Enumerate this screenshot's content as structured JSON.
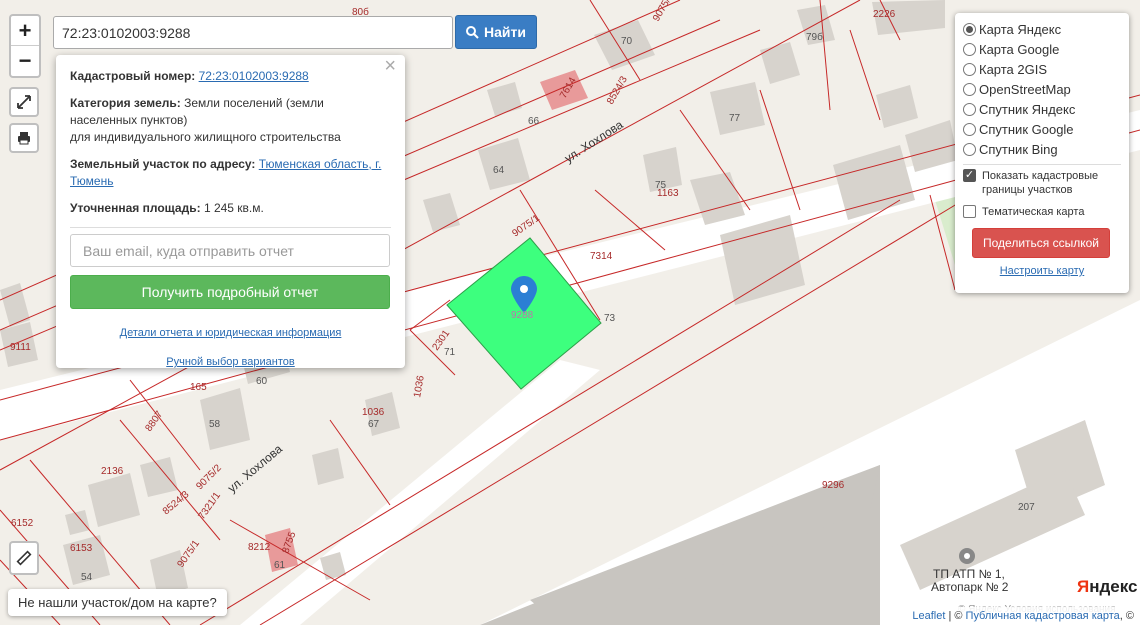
{
  "search": {
    "value": "72:23:0102003:9288",
    "button_label": "Найти"
  },
  "zoom": {
    "in": "+",
    "out": "−"
  },
  "popup": {
    "cadastral_label": "Кадастровый номер:",
    "cadastral_number": "72:23:0102003:9288",
    "category_label": "Категория земель:",
    "category_value": "Земли поселений (земли населенных пунктов)",
    "category_use": "для индивидуального жилищного строительства",
    "address_label": "Земельный участок по адресу:",
    "address_value": "Тюменская область, г. Тюмень",
    "area_label": "Уточненная площадь:",
    "area_value": "1 245 кв.м.",
    "email_placeholder": "Ваш email, куда отправить отчет",
    "report_button": "Получить подробный отчет",
    "details_link": "Детали отчета и юридическая информация",
    "manual_link": "Ручной выбор вариантов"
  },
  "layers": {
    "options": [
      {
        "label": "Карта Яндекс",
        "selected": true
      },
      {
        "label": "Карта Google",
        "selected": false
      },
      {
        "label": "Карта 2GIS",
        "selected": false
      },
      {
        "label": "OpenStreetMap",
        "selected": false
      },
      {
        "label": "Спутник Яндекс",
        "selected": false
      },
      {
        "label": "Спутник Google",
        "selected": false
      },
      {
        "label": "Спутник Bing",
        "selected": false
      }
    ],
    "show_borders": {
      "label": "Показать кадастровые границы участков",
      "checked": true
    },
    "thematic": {
      "label": "Тематическая карта",
      "checked": false
    },
    "share_button": "Поделиться ссылкой",
    "configure_link": "Настроить карту"
  },
  "bottom_tip": "Не нашли участок/дом на карте?",
  "attribution": {
    "leaflet": "Leaflet",
    "sep": " | © ",
    "source": "Публичная кадастровая карта",
    "tail": ", ©"
  },
  "yandex": {
    "logo_1": "Я",
    "logo_2": "ндекс",
    "legal": "© Яндекс  Условия использования"
  },
  "map_labels": {
    "street_1": "ул. Хохлова",
    "street_2": "ул. Хохлова",
    "l1": "80б",
    "l2": "70",
    "l3": "79б",
    "l4": "2226",
    "l5": "9075/1",
    "l6": "7614",
    "l7": "8524/3",
    "l8": "66",
    "l9": "77",
    "l10": "64",
    "l11": "75",
    "l12": "1163",
    "l13": "9075/1",
    "l14": "7314",
    "l15": "9288",
    "l16": "73",
    "l17": "2301",
    "l18": "71",
    "l19": "1036",
    "l20": "165",
    "l21": "60",
    "l22": "9111",
    "l23": "8807",
    "l24": "58",
    "l25": "1036",
    "l26": "67",
    "l27": "2136",
    "l28": "9075/2",
    "l29": "8524/3",
    "l30": "7321/1",
    "l31": "6152",
    "l32": "6153",
    "l33": "54",
    "l34": "9075/1",
    "l35": "8212",
    "l36": "8755",
    "l37": "61",
    "l38": "9296",
    "l39": "207",
    "poi_1": "ТП АТП № 1,",
    "poi_2": "Автопарк № 2"
  },
  "colors": {
    "parcel": "#3dff7e",
    "border": "#c62828",
    "marker": "#2b7fd4",
    "road": "#ffffff"
  }
}
